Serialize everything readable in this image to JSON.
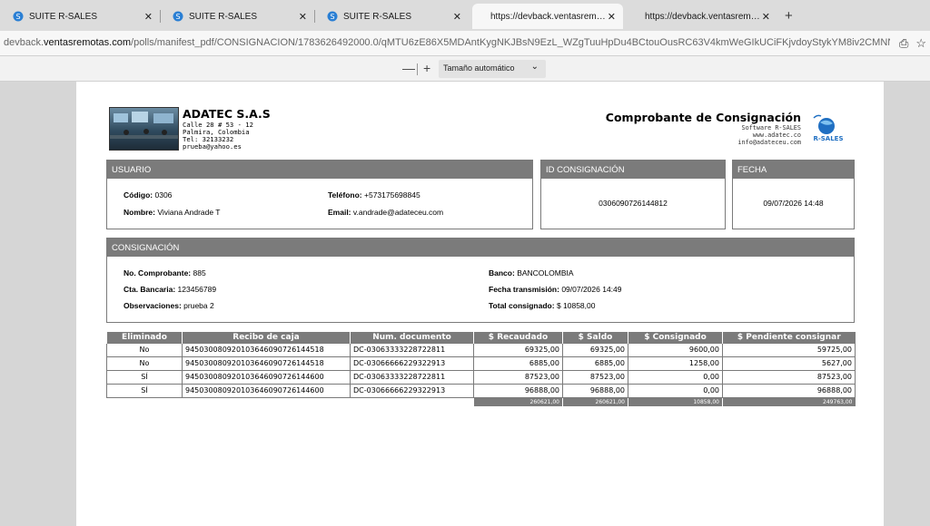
{
  "tabs": [
    {
      "title": "SUITE R-SALES",
      "close": "✕"
    },
    {
      "title": "SUITE R-SALES",
      "close": "✕"
    },
    {
      "title": "SUITE R-SALES",
      "close": "✕"
    },
    {
      "title": "https://devback.ventasremotas.",
      "close": "✕"
    },
    {
      "title": "https://devback.ventasremotas.",
      "close": "✕"
    }
  ],
  "new_tab": "+",
  "address": {
    "host": "devback.ventasremotas.com",
    "prefix": "devback.",
    "domain": "ventasremotas.com",
    "path": "/polls/manifest_pdf/CONSIGNACION/1783626492000.0/qMTU6zE86X5MDAntKygNKJBsN9EzL_WZgTuuHpDu4BCtouOusRC63V4kmWeGIkUCiFKjvdoyStykYM8iv2CMNNRwigsibJPzHiXy9"
  },
  "pdf_toolbar": {
    "zoom_out": "—",
    "zoom_in": "+",
    "zoom_label": "Tamaño automático"
  },
  "company": {
    "name": "ADATEC S.A.S",
    "address": "Calle 28 # 53 - 12",
    "city": "Palmira, Colombia",
    "phone": "Tel: 32133232",
    "email": "prueba@yahoo.es"
  },
  "document": {
    "title": "Comprobante de Consignación",
    "software": "Software R-SALES",
    "web": "www.adatec.co",
    "email": "info@adateceu.com",
    "brand": "R-SALES"
  },
  "usuario": {
    "header": "USUARIO",
    "codigo_label": "Código:",
    "codigo": "0306",
    "nombre_label": "Nombre:",
    "nombre": "Viviana Andrade T",
    "telefono_label": "Teléfono:",
    "telefono": "+573175698845",
    "email_label": "Email:",
    "email": "v.andrade@adateceu.com"
  },
  "id_consignacion": {
    "header": "ID CONSIGNACIÓN",
    "value": "0306090726144812"
  },
  "fecha": {
    "header": "FECHA",
    "value": "09/07/2026 14:48"
  },
  "consignacion": {
    "header": "CONSIGNACIÓN",
    "comprobante_label": "No. Comprobante:",
    "comprobante": "885",
    "cuenta_label": "Cta. Bancaria:",
    "cuenta": "123456789",
    "obs_label": "Observaciones:",
    "obs": "prueba 2",
    "banco_label": "Banco:",
    "banco": "BANCOLOMBIA",
    "fecha_label": "Fecha transmisión:",
    "fecha": "09/07/2026 14:49",
    "total_label": "Total consignado:",
    "total": "$ 10858,00"
  },
  "table": {
    "headers": [
      "Eliminado",
      "Recibo de caja",
      "Num. documento",
      "$ Recaudado",
      "$ Saldo",
      "$ Consignado",
      "$ Pendiente consignar"
    ],
    "rows": [
      [
        "No",
        "94503008092010364609072614451 8",
        "DC-03063333228722811",
        "69325,00",
        "69325,00",
        "9600,00",
        "59725,00"
      ],
      [
        "No",
        "945030080920103646090726144518",
        "DC-03066666229322913",
        "6885,00",
        "6885,00",
        "1258,00",
        "5627,00"
      ],
      [
        "SÍ",
        "945030080920103646090726144600",
        "DC-03063333228722811",
        "87523,00",
        "87523,00",
        "0,00",
        "87523,00"
      ],
      [
        "SÍ",
        "945030080920103646090726144600",
        "DC-03066666229322913",
        "96888,00",
        "96888,00",
        "0,00",
        "96888,00"
      ]
    ],
    "totals": [
      "260621,00",
      "260621,00",
      "10858,00",
      "249763,00"
    ]
  }
}
